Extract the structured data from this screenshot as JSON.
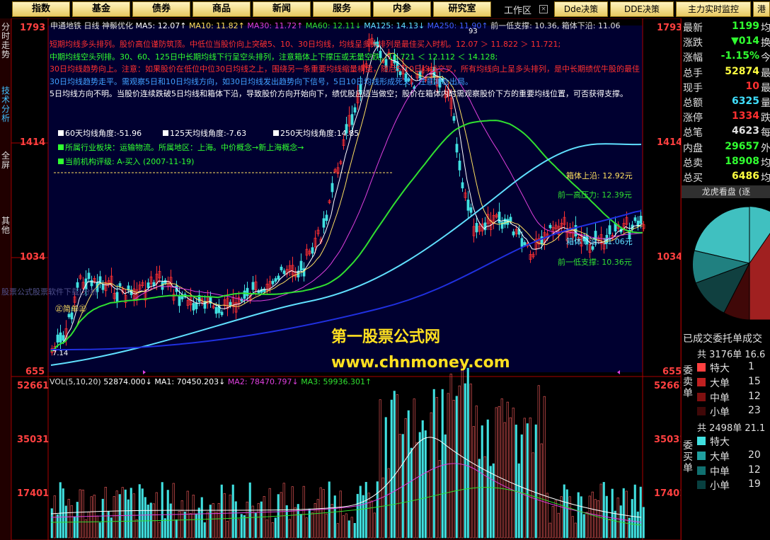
{
  "nav": {
    "buttons": [
      "指数",
      "基金",
      "债券",
      "商品",
      "新闻",
      "服务",
      "内参",
      "研究室"
    ],
    "workzone": "工作区",
    "right_buttons": [
      "Dde决策",
      "DDE决策",
      "主力实时监控",
      "港股"
    ]
  },
  "left_tabs": [
    {
      "label": "分时走势",
      "active": false
    },
    {
      "label": "技术分析",
      "active": true
    },
    {
      "label": "全屏",
      "active": false
    },
    {
      "label": "其他",
      "active": false
    }
  ],
  "header": {
    "stock": "申通地铁",
    "period": "日线",
    "indicator": "神鬃优化",
    "ma5": "MA5: 12.07↑",
    "ma10": "MA10: 11.82↑",
    "ma30": "MA30: 11.72↑",
    "ma60": "MA60: 12.11↓",
    "ma125": "MA125: 14.13↓",
    "ma250": "MA250: 11.90↑",
    "support_prev": "前一低支撑: 10.36,",
    "box_low": "箱体下沿: 11.06"
  },
  "commentary": [
    {
      "text": "短期均线多头排列。股价高位谨防筑顶。中低位当股价向上突破5、10、30日均线，均线呈多头排列是最佳买入时机。12.07 ＞ 11.822 ＞ 11.721;",
      "color": "#ff3030"
    },
    {
      "text": "中期均线空头列排。30、60、125日中长期均线下行呈空头排列，注意箱体上下撑压或无量空跌。11.721 ＜ 12.112 ＜ 14.128;",
      "color": "#30ff30"
    },
    {
      "text": "30日均线趋势向上。注意：如果股价在低位中位30日均线之上，围绕另一条重要均线缩量横盘，随后5-10日均线交叉，所有均线向上呈多头排列，是中长期绩优牛股的最佳",
      "color": "#ff3030"
    },
    {
      "text": "30日均线趋势走平。需观察5日和10日均线方向，如30日均线发出趋势向下信号，5日10日均线形成死叉，注意减仓出局。",
      "color": "#40a0ff"
    },
    {
      "text": "5日均线方向不明。当股价连续跌破5日均线和箱体下沿，导致股价方向开始向下，绩优股应适当做空；股价在箱体内时需观察股价下方的重要均线位置，可否获得支撑。",
      "color": "#ffffff"
    }
  ],
  "angles": {
    "a60": "60天均线角度:-51.96",
    "a125": "125天均线角度:-7.63",
    "a250": "250天均线角度:14.85",
    "industry": "所属行业板块：运输物流。所属地区：上海。中价概念→新上海概念→",
    "rating": "当前机构评级: A-买入  (2007-11-19)"
  },
  "chart_labels": {
    "box_top": "箱体上沿: 12.92元",
    "box_mid": "前一高压力: 12.39元",
    "box_bottom": "箱体下沿: 11.06元",
    "support": "前一低支撑: 10.36元",
    "peak": "93",
    "low_mark": "7.14",
    "simple": "㊣简单㊣",
    "watermark1": "第一股票公式网",
    "watermark2": "www.chnmoney.com",
    "faded": "股票公式股票软件下载[分析"
  },
  "price_axis": [
    "1793",
    "1414",
    "1034",
    "655"
  ],
  "volume_header": {
    "vol": "VOL(5,10,20)",
    "v": "52874.000↓",
    "ma1": "MA1: 70450.203↓",
    "ma2": "MA2: 78470.797↓",
    "ma3": "MA3: 59936.301↑"
  },
  "volume_axis": [
    "52661",
    "35031",
    "17401"
  ],
  "quote": {
    "rows": [
      {
        "label": "最新",
        "value": "1199",
        "color": "#30ff30",
        "suffix": "均"
      },
      {
        "label": "涨跌",
        "value": "▼014",
        "color": "#30ff30",
        "suffix": "换"
      },
      {
        "label": "涨幅",
        "value": "-1.15%",
        "color": "#30ff30",
        "suffix": "今"
      },
      {
        "label": "总手",
        "value": "52874",
        "color": "#ffff40",
        "suffix": "最"
      },
      {
        "label": "现手",
        "value": "10",
        "color": "#ff3030",
        "suffix": "最"
      },
      {
        "label": "总额",
        "value": "6325",
        "color": "#40e0ff",
        "suffix": "量"
      },
      {
        "label": "涨停",
        "value": "1334",
        "color": "#ff3030",
        "suffix": "跌"
      },
      {
        "label": "总笔",
        "value": "4623",
        "color": "#e0e0e0",
        "suffix": "每"
      },
      {
        "label": "内盘",
        "value": "29657",
        "color": "#30ff30",
        "suffix": "外"
      },
      {
        "label": "总卖",
        "value": "18908",
        "color": "#30ff30",
        "suffix": "均"
      },
      {
        "label": "总买",
        "value": "6486",
        "color": "#ffff40",
        "suffix": "均"
      }
    ],
    "section_title": "龙虎看盘 (逐",
    "deal_title": "已成交委托单成交",
    "sell_total": "共 3176单 16.6",
    "sell_label": "委卖单",
    "sell_rows": [
      {
        "label": "特大",
        "value": "1",
        "color": "#ff4040"
      },
      {
        "label": "大单",
        "value": "15",
        "color": "#c02020"
      },
      {
        "label": "中单",
        "value": "12",
        "color": "#801010"
      },
      {
        "label": "小单",
        "value": "23",
        "color": "#400808"
      }
    ],
    "buy_total": "共 2498单 21.1",
    "buy_label": "委买单",
    "buy_rows": [
      {
        "label": "特大",
        "value": "",
        "color": "#40e0e0"
      },
      {
        "label": "大单",
        "value": "20",
        "color": "#20a0a0"
      },
      {
        "label": "中单",
        "value": "12",
        "color": "#107070"
      },
      {
        "label": "小单",
        "value": "19",
        "color": "#084040"
      }
    ]
  },
  "colors": {
    "bg_top": "#000030",
    "ma_white": "#ffffff",
    "ma_yellow": "#ffe060",
    "ma_magenta": "#e040e0",
    "ma_green": "#30e030",
    "ma_cyan": "#60e0ff",
    "ma_blue": "#2030e0",
    "candle_up": "#ff3030"
  }
}
